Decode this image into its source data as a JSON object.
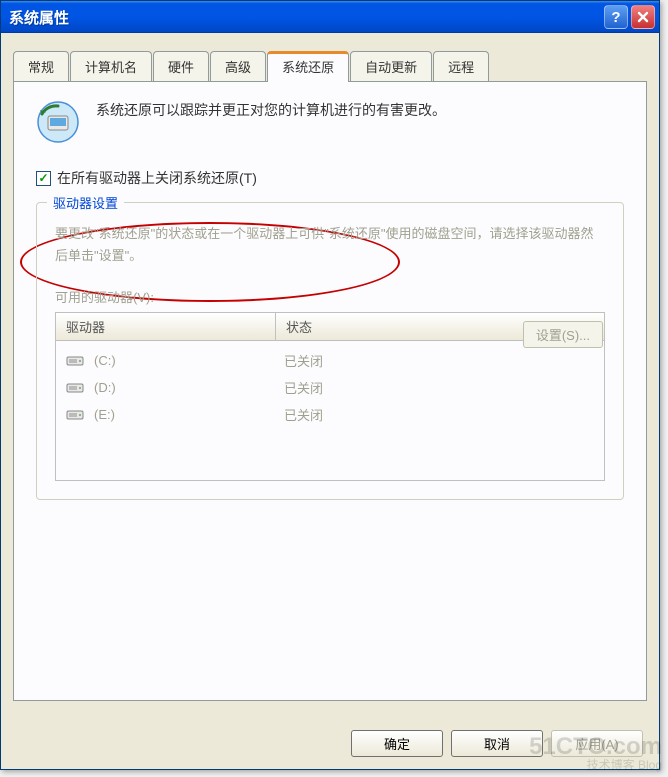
{
  "window": {
    "title": "系统属性"
  },
  "tabs": {
    "items": [
      {
        "label": "常规"
      },
      {
        "label": "计算机名"
      },
      {
        "label": "硬件"
      },
      {
        "label": "高级"
      },
      {
        "label": "系统还原"
      },
      {
        "label": "自动更新"
      },
      {
        "label": "远程"
      }
    ],
    "active_index": 4
  },
  "panel": {
    "intro": "系统还原可以跟踪并更正对您的计算机进行的有害更改。",
    "checkbox_label": "在所有驱动器上关闭系统还原(T)",
    "checkbox_checked": true,
    "group_title": "驱动器设置",
    "group_desc": "要更改\"系统还原\"的状态或在一个驱动器上可供\"系统还原\"使用的磁盘空间，请选择该驱动器然后单击\"设置\"。",
    "available_label": "可用的驱动器(V):",
    "columns": {
      "drive": "驱动器",
      "status": "状态"
    },
    "drives": [
      {
        "name": "(C:)",
        "status": "已关闭"
      },
      {
        "name": "(D:)",
        "status": "已关闭"
      },
      {
        "name": "(E:)",
        "status": "已关闭"
      }
    ],
    "settings_button": "设置(S)..."
  },
  "buttons": {
    "ok": "确定",
    "cancel": "取消",
    "apply": "应用(A)"
  },
  "watermark": {
    "main": "51CTO.com",
    "sub": "技术博客   Blog"
  }
}
